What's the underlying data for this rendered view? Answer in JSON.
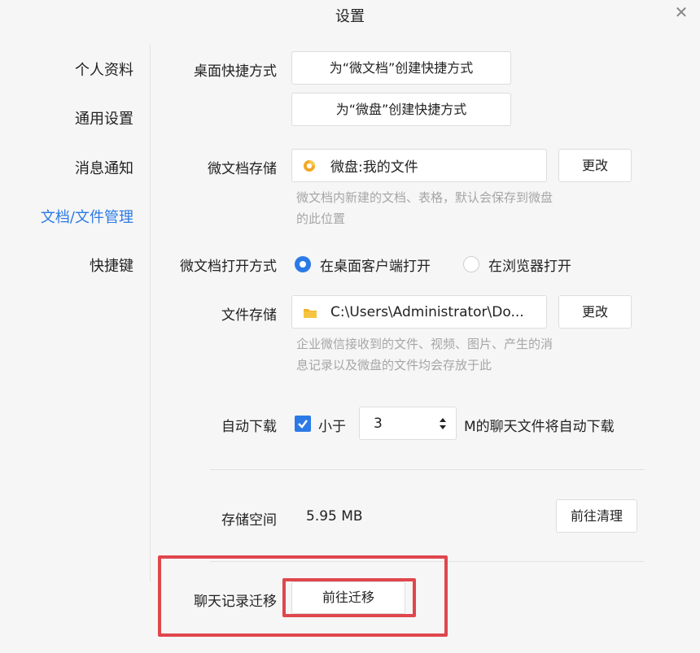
{
  "window": {
    "title": "设置",
    "close_icon": "close-icon"
  },
  "sidebar": {
    "items": [
      {
        "label": "个人资料",
        "active": false
      },
      {
        "label": "通用设置",
        "active": false
      },
      {
        "label": "消息通知",
        "active": false
      },
      {
        "label": "文档/文件管理",
        "active": true
      },
      {
        "label": "快捷键",
        "active": false
      }
    ]
  },
  "shortcut": {
    "label": "桌面快捷方式",
    "doc_button": "为“微文档”创建快捷方式",
    "disk_button": "为“微盘”创建快捷方式"
  },
  "doc_storage": {
    "label": "微文档存储",
    "path": "微盘:我的文件",
    "change_button": "更改",
    "hint_line1": "微文档内新建的文档、表格，默认会保存到微盘",
    "hint_line2": "的此位置"
  },
  "open_mode": {
    "label": "微文档打开方式",
    "option1": "在桌面客户端打开",
    "option2": "在浏览器打开",
    "selected": "option1"
  },
  "file_storage": {
    "label": "文件存储",
    "path": "C:\\Users\\Administrator\\Do...",
    "change_button": "更改",
    "hint_line1": "企业微信接收到的文件、视频、图片、产生的消",
    "hint_line2": "息记录以及微盘的文件均会存放于此"
  },
  "auto_download": {
    "label": "自动下载",
    "checked": true,
    "prefix": "小于",
    "value": "3",
    "suffix": "M的聊天文件将自动下载"
  },
  "storage_space": {
    "label": "存储空间",
    "value": "5.95 MB",
    "clean_button": "前往清理"
  },
  "migration": {
    "label": "聊天记录迁移",
    "button": "前往迁移"
  },
  "colors": {
    "accent": "#2c7ae6",
    "highlight": "#e0464d"
  }
}
